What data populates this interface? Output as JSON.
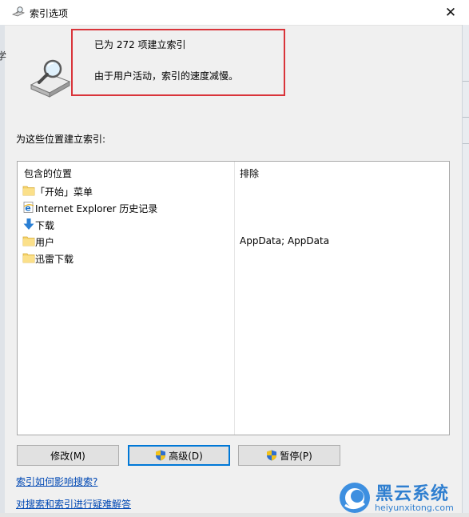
{
  "window": {
    "title": "索引选项",
    "close_glyph": "✕"
  },
  "status": {
    "indexed_text": "已为 272 项建立索引",
    "activity_text": "由于用户活动，索引的速度减慢。"
  },
  "locations_label": "为这些位置建立索引:",
  "table": {
    "header_included": "包含的位置",
    "header_excluded": "排除",
    "rows": [
      {
        "name": "「开始」菜单",
        "excluded": "",
        "icon": "folder-icon"
      },
      {
        "name": "Internet Explorer 历史记录",
        "excluded": "",
        "icon": "internet-explorer-icon"
      },
      {
        "name": "下载",
        "excluded": "",
        "icon": "download-arrow-icon"
      },
      {
        "name": "用户",
        "excluded": "AppData; AppData",
        "icon": "folder-icon"
      },
      {
        "name": "迅雷下载",
        "excluded": "",
        "icon": "folder-icon"
      }
    ]
  },
  "buttons": {
    "modify_label": "修改(M)",
    "advanced_label": "高级(D)",
    "pause_label": "暂停(P)"
  },
  "links": {
    "affect_search": "索引如何影响搜索?",
    "troubleshoot": "对搜索和索引进行疑难解答"
  },
  "left_sliver_char": "学",
  "watermark": {
    "name": "黑云系统",
    "url": "heiyunxitong.com"
  },
  "colors": {
    "accent": "#0078d7",
    "link": "#0048b4",
    "highlight": "#d9343a",
    "folder": "#f5d36b",
    "watermark": "#2f7fd0"
  }
}
